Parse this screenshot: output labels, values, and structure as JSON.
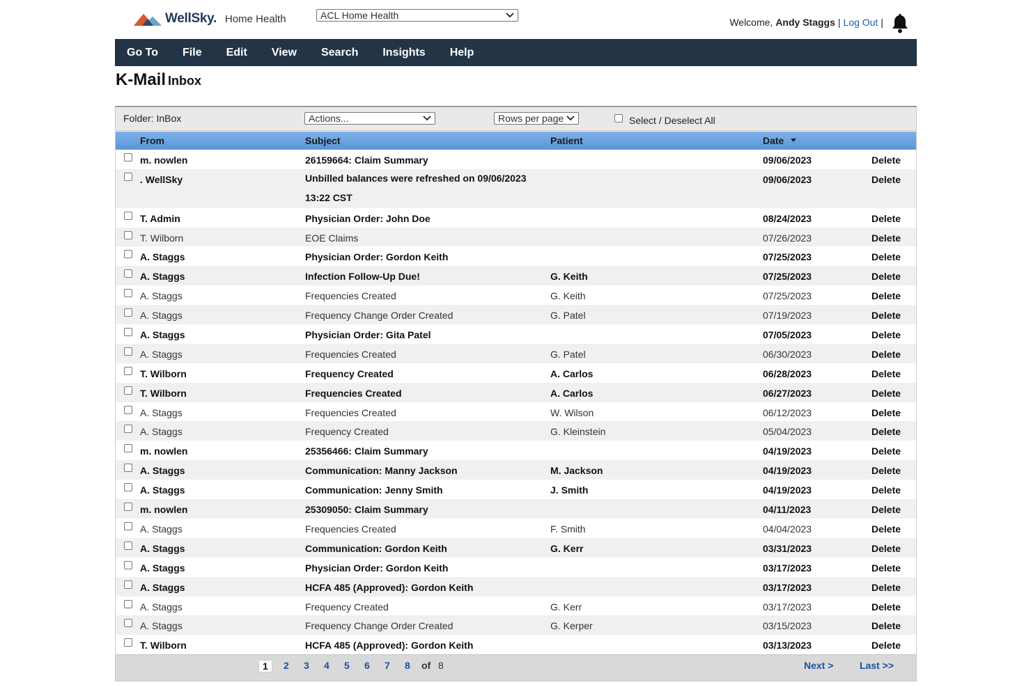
{
  "header": {
    "brand": "WellSky.",
    "product": "Home Health",
    "agency": "ACL Home Health",
    "welcome": "Welcome,",
    "user": "Andy Staggs",
    "sep": "|",
    "logout": "Log Out"
  },
  "menu": [
    "Go To",
    "File",
    "Edit",
    "View",
    "Search",
    "Insights",
    "Help"
  ],
  "page": {
    "title": "K-Mail",
    "subtitle": "Inbox"
  },
  "toolbar": {
    "folder": "Folder:  InBox",
    "actions": "Actions...",
    "rows_per_page": "Rows per page",
    "select_all": "Select / Deselect All"
  },
  "table": {
    "columns": {
      "from": "From",
      "subject": "Subject",
      "patient": "Patient",
      "date": "Date"
    },
    "delete_label": "Delete",
    "rows": [
      {
        "from": "m. nowlen",
        "subject": "26159664: Claim Summary",
        "patient": "",
        "date": "09/06/2023",
        "bold": true
      },
      {
        "from": ". WellSky",
        "subject": "Unbilled balances were refreshed on 09/06/2023 13:22 CST",
        "patient": "",
        "date": "09/06/2023",
        "bold": true,
        "tall": true
      },
      {
        "from": "T. Admin",
        "subject": "Physician Order: John Doe",
        "patient": "",
        "date": "08/24/2023",
        "bold": true
      },
      {
        "from": "T. Wilborn",
        "subject": "EOE Claims",
        "patient": "",
        "date": "07/26/2023",
        "bold": false
      },
      {
        "from": "A. Staggs",
        "subject": "Physician Order: Gordon Keith",
        "patient": "",
        "date": "07/25/2023",
        "bold": true
      },
      {
        "from": "A. Staggs",
        "subject": "Infection Follow-Up Due!",
        "patient": "G. Keith",
        "date": "07/25/2023",
        "bold": true
      },
      {
        "from": "A. Staggs",
        "subject": "Frequencies Created",
        "patient": "G. Keith",
        "date": "07/25/2023",
        "bold": false
      },
      {
        "from": "A. Staggs",
        "subject": "Frequency Change Order Created",
        "patient": "G. Patel",
        "date": "07/19/2023",
        "bold": false
      },
      {
        "from": "A. Staggs",
        "subject": "Physician Order: Gita Patel",
        "patient": "",
        "date": "07/05/2023",
        "bold": true
      },
      {
        "from": "A. Staggs",
        "subject": "Frequencies Created",
        "patient": "G. Patel",
        "date": "06/30/2023",
        "bold": false
      },
      {
        "from": "T. Wilborn",
        "subject": "Frequency Created",
        "patient": "A. Carlos",
        "date": "06/28/2023",
        "bold": true
      },
      {
        "from": "T. Wilborn",
        "subject": "Frequencies Created",
        "patient": "A. Carlos",
        "date": "06/27/2023",
        "bold": true
      },
      {
        "from": "A. Staggs",
        "subject": "Frequencies Created",
        "patient": "W. Wilson",
        "date": "06/12/2023",
        "bold": false
      },
      {
        "from": "A. Staggs",
        "subject": "Frequency Created",
        "patient": "G. Kleinstein",
        "date": "05/04/2023",
        "bold": false
      },
      {
        "from": "m. nowlen",
        "subject": "25356466: Claim Summary",
        "patient": "",
        "date": "04/19/2023",
        "bold": true
      },
      {
        "from": "A. Staggs",
        "subject": "Communication: Manny Jackson",
        "patient": "M. Jackson",
        "date": "04/19/2023",
        "bold": true
      },
      {
        "from": "A. Staggs",
        "subject": "Communication: Jenny Smith",
        "patient": "J. Smith",
        "date": "04/19/2023",
        "bold": true
      },
      {
        "from": "m. nowlen",
        "subject": "25309050: Claim Summary",
        "patient": "",
        "date": "04/11/2023",
        "bold": true
      },
      {
        "from": "A. Staggs",
        "subject": "Frequencies Created",
        "patient": "F. Smith",
        "date": "04/04/2023",
        "bold": false
      },
      {
        "from": "A. Staggs",
        "subject": "Communication: Gordon Keith",
        "patient": "G. Kerr",
        "date": "03/31/2023",
        "bold": true
      },
      {
        "from": "A. Staggs",
        "subject": "Physician Order: Gordon Keith",
        "patient": "",
        "date": "03/17/2023",
        "bold": true
      },
      {
        "from": "A. Staggs",
        "subject": "HCFA 485 (Approved): Gordon Keith",
        "patient": "",
        "date": "03/17/2023",
        "bold": true
      },
      {
        "from": "A. Staggs",
        "subject": "Frequency Created",
        "patient": "G. Kerr",
        "date": "03/17/2023",
        "bold": false
      },
      {
        "from": "A. Staggs",
        "subject": "Frequency Change Order Created",
        "patient": "G. Kerper",
        "date": "03/15/2023",
        "bold": false
      },
      {
        "from": "T. Wilborn",
        "subject": "HCFA 485 (Approved): Gordon Keith",
        "patient": "",
        "date": "03/13/2023",
        "bold": true
      }
    ]
  },
  "pagination": {
    "pages": [
      "1",
      "2",
      "3",
      "4",
      "5",
      "6",
      "7",
      "8"
    ],
    "current": "1",
    "of": "of",
    "total": "8",
    "next": "Next >",
    "last": "Last >>"
  }
}
